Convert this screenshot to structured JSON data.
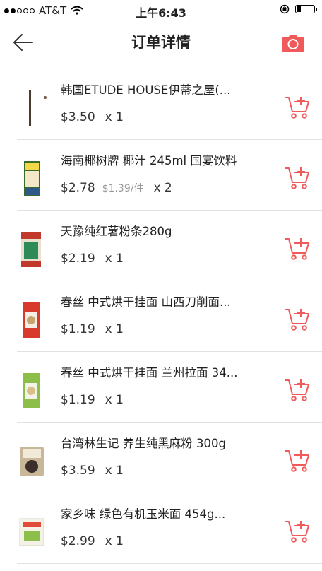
{
  "status_bar": {
    "carrier": "AT&T",
    "time": "上午6:43",
    "signal_bars_filled": 2,
    "signal_bars_total": 5,
    "battery_level": 0.25
  },
  "header": {
    "title": "订单详情",
    "back_icon": "arrow-left-icon",
    "camera_icon": "camera-icon",
    "accent_color": "#f05a5a"
  },
  "items": [
    {
      "name": "韩国ETUDE HOUSE伊蒂之屋(...",
      "price": "$3.50",
      "unit_price": "",
      "qty": "x 1",
      "thumb": "eyebrow-pencil"
    },
    {
      "name": "海南椰树牌 椰汁 245ml 国宴饮料",
      "price": "$2.78",
      "unit_price": "$1.39/件",
      "qty": "x 2",
      "thumb": "coconut-juice"
    },
    {
      "name": "天豫纯红薯粉条280g",
      "price": "$2.19",
      "unit_price": "",
      "qty": "x 1",
      "thumb": "noodles-pack"
    },
    {
      "name": "春丝 中式烘干挂面 山西刀削面...",
      "price": "$1.19",
      "unit_price": "",
      "qty": "x 1",
      "thumb": "noodles-red"
    },
    {
      "name": "春丝 中式烘干挂面 兰州拉面 34...",
      "price": "$1.19",
      "unit_price": "",
      "qty": "x 1",
      "thumb": "noodles-green"
    },
    {
      "name": "台湾林生记 养生纯黑麻粉 300g",
      "price": "$3.59",
      "unit_price": "",
      "qty": "x 1",
      "thumb": "sesame-powder"
    },
    {
      "name": "家乡味 绿色有机玉米面 454g...",
      "price": "$2.99",
      "unit_price": "",
      "qty": "x 1",
      "thumb": "corn-flour"
    }
  ]
}
